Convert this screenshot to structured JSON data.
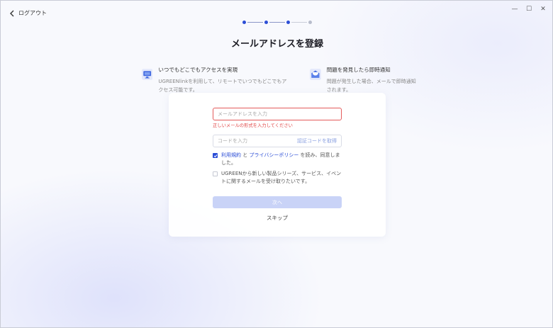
{
  "window": {
    "minimize": "—",
    "maximize": "☐",
    "close": "✕"
  },
  "header": {
    "back_label": "ログアウト",
    "title": "メールアドレスを登録",
    "steps": {
      "total": 4,
      "completed": 3
    }
  },
  "features": [
    {
      "icon": "monitor-icon",
      "title": "いつでもどこでもアクセスを実現",
      "desc": "UGREENlinkを利用して、リモートでいつでもどこでもアクセス可能です。"
    },
    {
      "icon": "mail-icon",
      "title": "問題を発見したら即時通知",
      "desc": "問題が発生した場合、メールで即時通知されます。"
    }
  ],
  "form": {
    "email_placeholder": "メールアドレスを入力",
    "email_value": "",
    "email_error": "正しいメールの形式を入力してください",
    "code_placeholder": "コードを入力",
    "code_value": "",
    "get_code_label": "認証コードを取得",
    "terms": {
      "checked": true,
      "link1": "利用規約",
      "and": " と ",
      "link2": "プライバシーポリシー",
      "suffix": " を読み、同意しました。"
    },
    "newsletter": {
      "checked": false,
      "text": "UGREENから新しい製品シリーズ、サービス、イベントに関するメールを受け取りたいです。"
    },
    "next_label": "次へ",
    "skip_label": "スキップ"
  },
  "colors": {
    "accent": "#2c4ed6",
    "error": "#e04545",
    "button_disabled": "#c9d3f7"
  }
}
